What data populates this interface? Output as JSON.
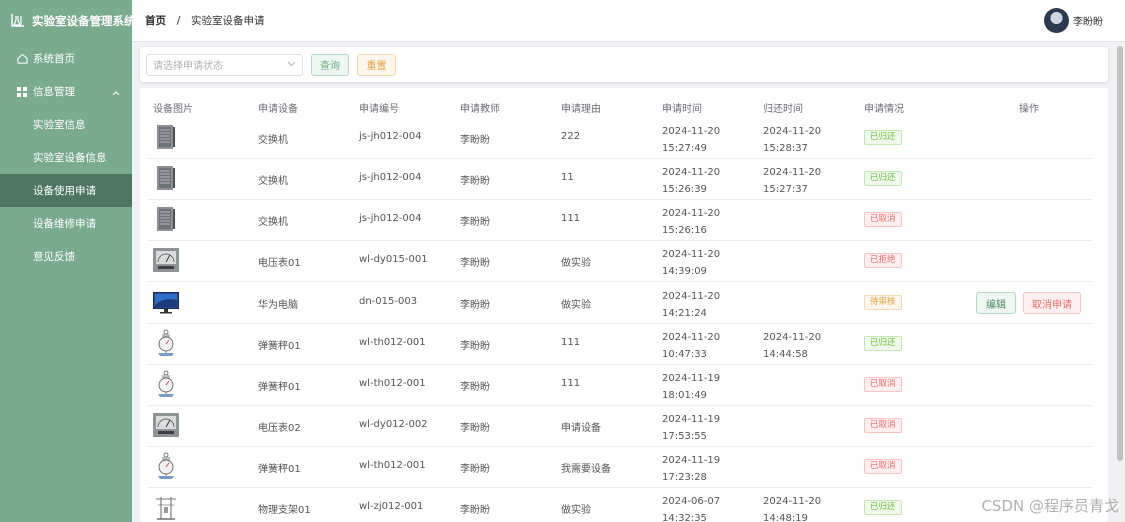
{
  "app": {
    "title": "实验室设备管理系统"
  },
  "sidebar": {
    "items": [
      {
        "label": "系统首页",
        "icon": "home-icon"
      },
      {
        "label": "信息管理",
        "icon": "grid-icon"
      },
      {
        "label": "实验室信息"
      },
      {
        "label": "实验室设备信息"
      },
      {
        "label": "设备使用申请",
        "active": true
      },
      {
        "label": "设备维修申请"
      },
      {
        "label": "意见反馈"
      }
    ]
  },
  "header": {
    "breadcrumb_home": "首页",
    "breadcrumb_sep": "/",
    "breadcrumb_current": "实验室设备申请",
    "user_name": "李盼盼"
  },
  "search": {
    "placeholder": "请选择申请状态",
    "query_label": "查询",
    "reset_label": "重置"
  },
  "table": {
    "headers": [
      "设备图片",
      "申请设备",
      "申请编号",
      "申请教师",
      "申请理由",
      "申请时间",
      "归还时间",
      "申请情况",
      "操作"
    ],
    "rows": [
      {
        "image": "switch-icon",
        "device": "交换机",
        "code": "js-jh012-004",
        "teacher": "李盼盼",
        "reason": "222",
        "apply_date": "2024-11-20",
        "apply_time": "15:27:49",
        "return_date": "2024-11-20",
        "return_time": "15:28:37",
        "status": "已归还",
        "status_color": "green"
      },
      {
        "image": "switch-icon",
        "device": "交换机",
        "code": "js-jh012-004",
        "teacher": "李盼盼",
        "reason": "11",
        "apply_date": "2024-11-20",
        "apply_time": "15:26:39",
        "return_date": "2024-11-20",
        "return_time": "15:27:37",
        "status": "已归还",
        "status_color": "green"
      },
      {
        "image": "switch-icon",
        "device": "交换机",
        "code": "js-jh012-004",
        "teacher": "李盼盼",
        "reason": "111",
        "apply_date": "2024-11-20",
        "apply_time": "15:26:16",
        "return_date": "",
        "return_time": "",
        "status": "已取消",
        "status_color": "red"
      },
      {
        "image": "voltmeter-icon",
        "device": "电压表01",
        "code": "wl-dy015-001",
        "teacher": "李盼盼",
        "reason": "做实验",
        "apply_date": "2024-11-20",
        "apply_time": "14:39:09",
        "return_date": "",
        "return_time": "",
        "status": "已拒绝",
        "status_color": "red"
      },
      {
        "image": "computer-icon",
        "device": "华为电脑",
        "code": "dn-015-003",
        "teacher": "李盼盼",
        "reason": "做实验",
        "apply_date": "2024-11-20",
        "apply_time": "14:21:24",
        "return_date": "",
        "return_time": "",
        "status": "待审核",
        "status_color": "yellow",
        "actions": [
          "编辑",
          "取消申请"
        ]
      },
      {
        "image": "scale-icon",
        "device": "弹簧秤01",
        "code": "wl-th012-001",
        "teacher": "李盼盼",
        "reason": "111",
        "apply_date": "2024-11-20",
        "apply_time": "10:47:33",
        "return_date": "2024-11-20",
        "return_time": "14:44:58",
        "status": "已归还",
        "status_color": "green"
      },
      {
        "image": "scale-icon",
        "device": "弹簧秤01",
        "code": "wl-th012-001",
        "teacher": "李盼盼",
        "reason": "111",
        "apply_date": "2024-11-19",
        "apply_time": "18:01:49",
        "return_date": "",
        "return_time": "",
        "status": "已取消",
        "status_color": "red"
      },
      {
        "image": "voltmeter-icon",
        "device": "电压表02",
        "code": "wl-dy012-002",
        "teacher": "李盼盼",
        "reason": "申请设备",
        "apply_date": "2024-11-19",
        "apply_time": "17:53:55",
        "return_date": "",
        "return_time": "",
        "status": "已取消",
        "status_color": "red"
      },
      {
        "image": "scale-icon",
        "device": "弹簧秤01",
        "code": "wl-th012-001",
        "teacher": "李盼盼",
        "reason": "我需要设备",
        "apply_date": "2024-11-19",
        "apply_time": "17:23:28",
        "return_date": "",
        "return_time": "",
        "status": "已取消",
        "status_color": "red"
      },
      {
        "image": "stand-icon",
        "device": "物理支架01",
        "code": "wl-zj012-001",
        "teacher": "李盼盼",
        "reason": "做实验",
        "apply_date": "2024-06-07",
        "apply_time": "14:32:35",
        "return_date": "2024-11-20",
        "return_time": "14:48:19",
        "status": "已归还",
        "status_color": "green"
      }
    ]
  },
  "watermark": "CSDN @程序员青戈"
}
